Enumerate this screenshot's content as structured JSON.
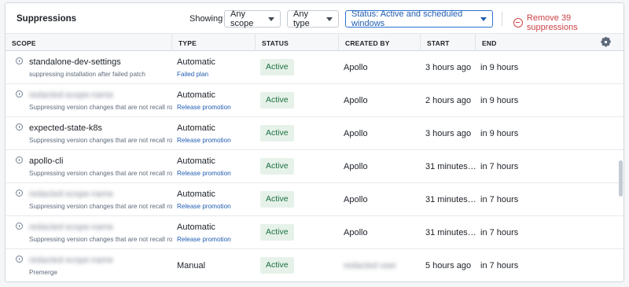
{
  "header": {
    "title": "Suppressions",
    "showing_label": "Showing",
    "scope_filter": "Any scope",
    "type_filter": "Any type",
    "status_filter": "Status: Active and scheduled windows",
    "remove_label": "Remove 39 suppressions"
  },
  "columns": [
    "SCOPE",
    "TYPE",
    "STATUS",
    "CREATED BY",
    "START",
    "END"
  ],
  "rows": [
    {
      "scope": "standalone-dev-settings",
      "scope_blurred": false,
      "desc": "suppressing installation after failed patch",
      "type": "Automatic",
      "type_detail": "Failed plan",
      "status": "Active",
      "created_by": "Apollo",
      "created_by_blurred": false,
      "start": "3 hours ago",
      "end": "in 9 hours"
    },
    {
      "scope": "",
      "scope_blurred": true,
      "desc": "Suppressing version changes that are not recall rollout",
      "type": "Automatic",
      "type_detail": "Release promotion",
      "status": "Active",
      "created_by": "Apollo",
      "created_by_blurred": false,
      "start": "2 hours ago",
      "end": "in 9 hours"
    },
    {
      "scope": "expected-state-k8s",
      "scope_blurred": false,
      "desc": "Suppressing version changes that are not recall rollout",
      "type": "Automatic",
      "type_detail": "Release promotion",
      "status": "Active",
      "created_by": "Apollo",
      "created_by_blurred": false,
      "start": "3 hours ago",
      "end": "in 9 hours"
    },
    {
      "scope": "apollo-cli",
      "scope_blurred": false,
      "desc": "Suppressing version changes that are not recall rollout",
      "type": "Automatic",
      "type_detail": "Release promotion",
      "status": "Active",
      "created_by": "Apollo",
      "created_by_blurred": false,
      "start": "31 minutes…",
      "end": "in 7 hours"
    },
    {
      "scope": "",
      "scope_blurred": true,
      "desc": "Suppressing version changes that are not recall rollout",
      "type": "Automatic",
      "type_detail": "Release promotion",
      "status": "Active",
      "created_by": "Apollo",
      "created_by_blurred": false,
      "start": "31 minutes…",
      "end": "in 7 hours"
    },
    {
      "scope": "",
      "scope_blurred": true,
      "desc": "Suppressing version changes that are not recall rollout",
      "type": "Automatic",
      "type_detail": "Release promotion",
      "status": "Active",
      "created_by": "Apollo",
      "created_by_blurred": false,
      "start": "31 minutes…",
      "end": "in 7 hours"
    },
    {
      "scope": "",
      "scope_blurred": true,
      "desc": "Premerge",
      "type": "Manual",
      "type_detail": "",
      "status": "Active",
      "created_by": "",
      "created_by_blurred": true,
      "start": "5 hours ago",
      "end": "in 7 hours"
    }
  ],
  "colors": {
    "accent": "#2d72d2",
    "danger": "#cd4246",
    "active_bg": "#e6f2e9",
    "active_text": "#1c6e42"
  }
}
